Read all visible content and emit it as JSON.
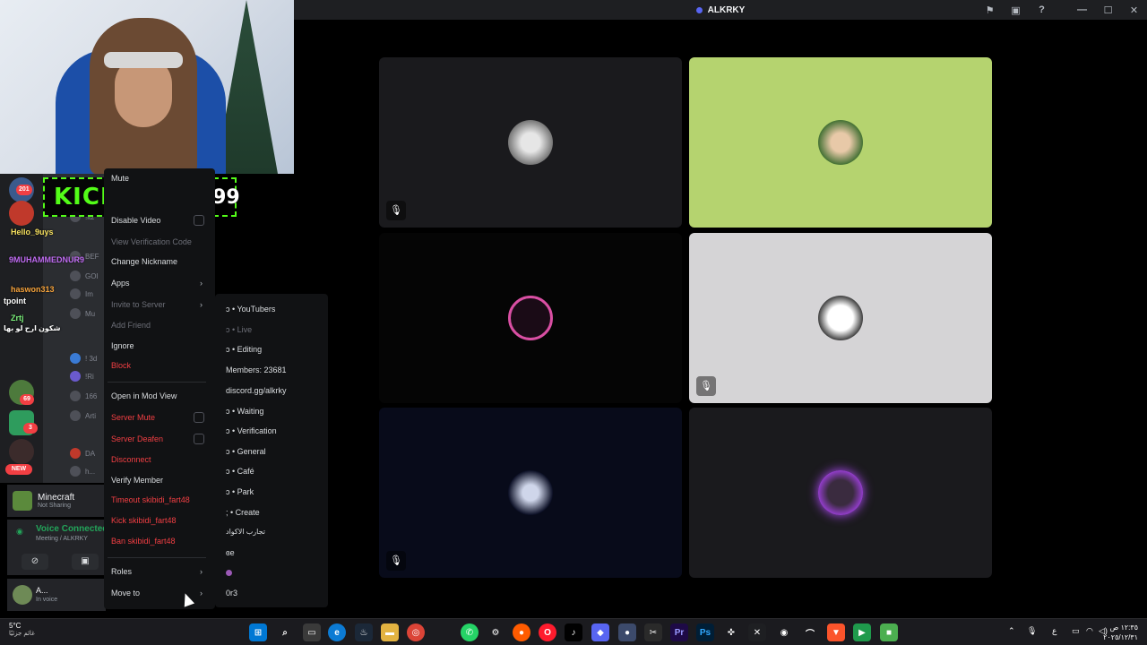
{
  "window": {
    "title": "ALKRKY"
  },
  "stream_overlay": {
    "kick_label": "KICK",
    "kick_user": "ALKRKY99"
  },
  "chat_names": [
    {
      "text": "Hello_9uys",
      "color": "#f6e05e"
    },
    {
      "text": "9MUHAMMEDNUR9",
      "color": "#c06cf2"
    },
    {
      "text": "haswon313",
      "color": "#f6a33c"
    },
    {
      "text": "Zrtj",
      "color": "#7cf27c"
    },
    {
      "text": "tpoint",
      "color": "#ffffff"
    },
    {
      "text": "شكون ارح لو بها",
      "color": "#ffffff"
    }
  ],
  "guild_badges": [
    "201",
    "69",
    "3",
    "NEW"
  ],
  "members_partial": [
    "!itz",
    "BEF",
    "GOI",
    "Im",
    "Mu",
    "! 3d",
    "!Ri",
    "166",
    "Arti",
    "DA",
    "h..."
  ],
  "activity": {
    "title": "Minecraft",
    "subtitle": "Not Sharing"
  },
  "voice": {
    "status": "Voice Connected",
    "channel": "Meeting / ALKRKY"
  },
  "user": {
    "name": "A...",
    "status": "In voice"
  },
  "context_menu": {
    "mute": "Mute",
    "disable_video": "Disable Video",
    "view_verification_code": "View Verification Code",
    "change_nickname": "Change Nickname",
    "apps": "Apps",
    "invite_to_server": "Invite to Server",
    "add_friend": "Add Friend",
    "ignore": "Ignore",
    "block": "Block",
    "open_in_mod_view": "Open in Mod View",
    "server_mute": "Server Mute",
    "server_deafen": "Server Deafen",
    "disconnect": "Disconnect",
    "verify_member": "Verify Member",
    "timeout": "Timeout skibidi_fart48",
    "kick": "Kick skibidi_fart48",
    "ban": "Ban skibidi_fart48",
    "roles": "Roles",
    "move_to": "Move to"
  },
  "move_to_channels": [
    "ↄ • YouTubers",
    "ↄ • Live",
    "ↄ • Editing",
    "Members: 23681",
    "discord.gg/alkrky",
    "ↄ • Waiting",
    "ↄ • Verification",
    "ↄ • General",
    "ↄ • Café",
    "ↄ • Park",
    "; • Create",
    "تجارب الاكواد",
    "ɞe",
    "",
    "0r3"
  ],
  "tile_colors": {
    "tile1": "#1a1a1d",
    "tile2": "#b5d36f",
    "tile3": "#050505",
    "tile4": "#d5d4d6",
    "tile5": "#080b1a",
    "tile6": "#1a1a1d"
  },
  "taskbar": {
    "weather_temp": "5°C",
    "weather_desc": "غائم جزئيًا",
    "time": "١٢:٣٥ ص",
    "date": "٢٠٢٥/١٢/٣١",
    "lang": "ع"
  }
}
